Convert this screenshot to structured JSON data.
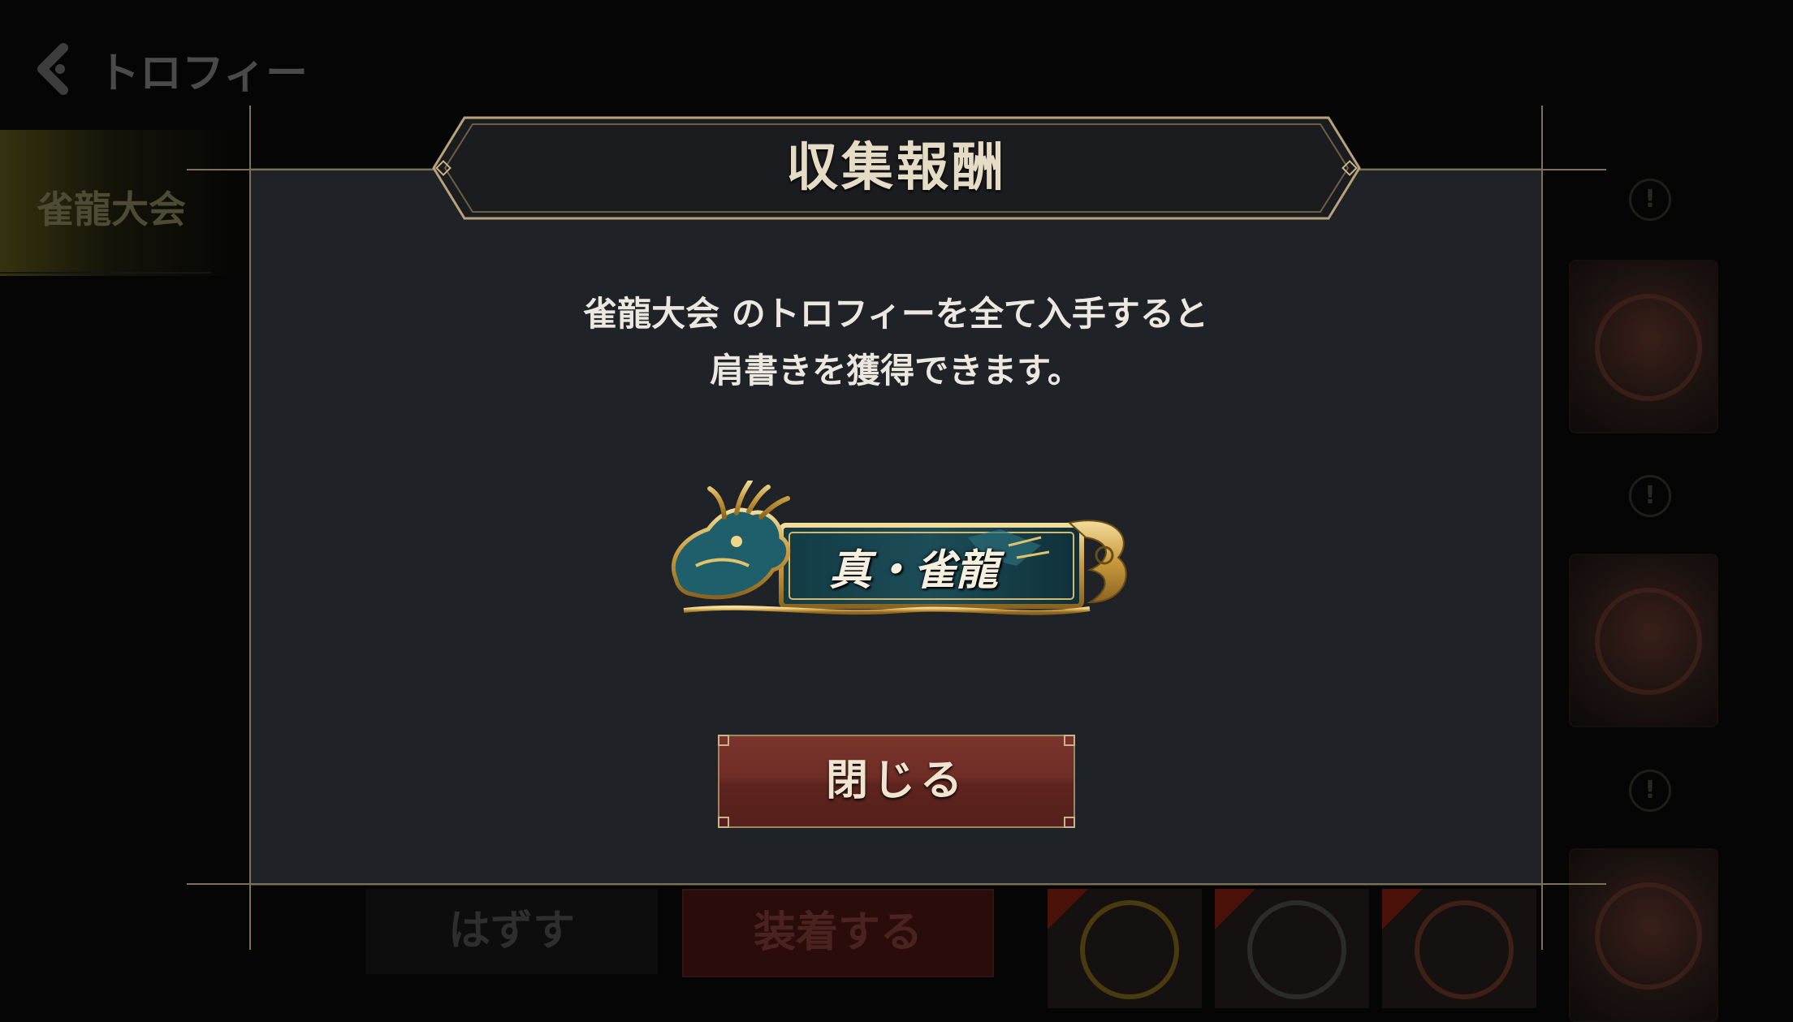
{
  "background": {
    "header": {
      "title": "トロフィー"
    },
    "sidebar": {
      "selected_label": "雀龍大会"
    },
    "bottom_bar": {
      "remove_label": "はずす",
      "equip_label": "装着する"
    }
  },
  "modal": {
    "title": "収集報酬",
    "description_lines": [
      "雀龍大会 のトロフィーを全て入手すると",
      "肩書きを獲得できます。"
    ],
    "reward_title": "真・雀龍",
    "close_label": "閉じる"
  },
  "icons": {
    "back": "chevron-left-icon",
    "info": "info-icon",
    "dragon": "dragon-emblem-icon"
  },
  "colors": {
    "panel": "#1f2328",
    "gold_frame": "#c9b48a",
    "close_button": "#6e2d26",
    "emblem_teal": "#1e5a66"
  }
}
